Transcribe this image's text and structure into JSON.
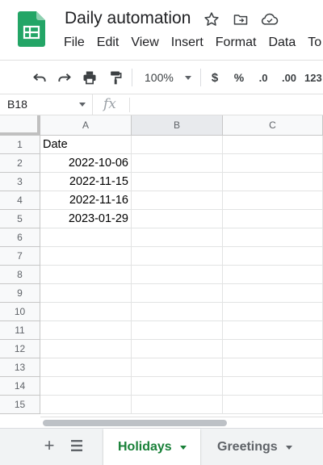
{
  "app": {
    "title": "Daily automation",
    "logo_icon": "google-sheets-logo",
    "accent": "#188038",
    "logo_color": "#23a566"
  },
  "menu": [
    "File",
    "Edit",
    "View",
    "Insert",
    "Format",
    "Data",
    "To"
  ],
  "toolbar": {
    "zoom": "100%",
    "currency": "$",
    "percent": "%",
    "decrease_decimals": ".0",
    "increase_decimals": ".00",
    "more_formats": "123"
  },
  "formula_bar": {
    "cell_ref": "B18",
    "fx": "fx",
    "value": ""
  },
  "columns": [
    "A",
    "B",
    "C"
  ],
  "rows": [
    "1",
    "2",
    "3",
    "4",
    "5",
    "6",
    "7",
    "8",
    "9",
    "10",
    "11",
    "12",
    "13",
    "14",
    "15"
  ],
  "cells": {
    "A1": "Date",
    "A2": "2022-10-06",
    "A3": "2022-11-15",
    "A4": "2022-11-16",
    "A5": "2023-01-29"
  },
  "sheets": {
    "active": "Holidays",
    "other": "Greetings"
  }
}
